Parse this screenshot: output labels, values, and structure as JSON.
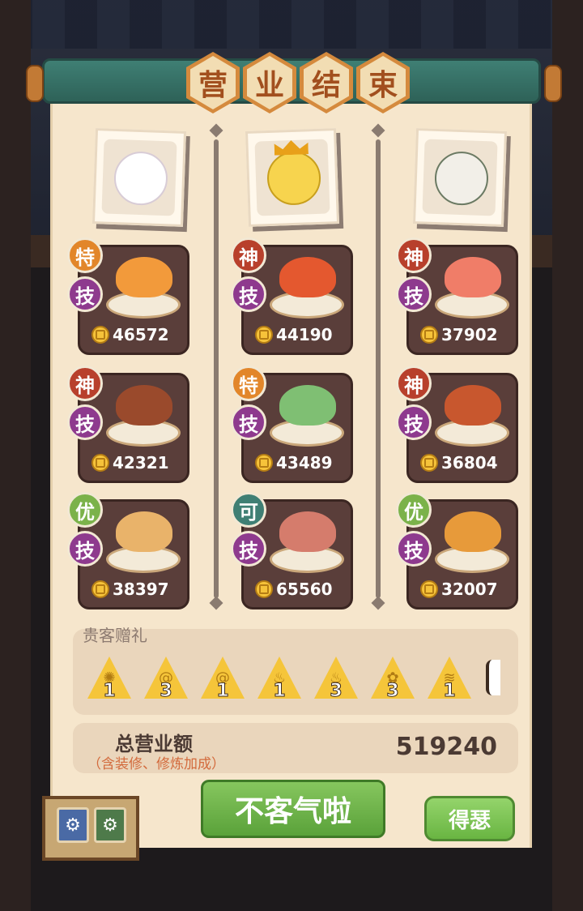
{
  "title_chars": [
    "营",
    "业",
    "结",
    "束"
  ],
  "columns": [
    {
      "portrait": "cat-character",
      "dishes": [
        {
          "grade": "特",
          "grade_color": "#e2862a",
          "skill": "技",
          "value": "46572",
          "food_color": "#f29a3b"
        },
        {
          "grade": "神",
          "grade_color": "#b8402c",
          "skill": "技",
          "value": "42321",
          "food_color": "#9a4a2c"
        },
        {
          "grade": "优",
          "grade_color": "#7bb24a",
          "skill": "技",
          "value": "38397",
          "food_color": "#e9b36a"
        }
      ]
    },
    {
      "portrait": "chick-king-character",
      "dishes": [
        {
          "grade": "神",
          "grade_color": "#b8402c",
          "skill": "技",
          "value": "44190",
          "food_color": "#e4582f"
        },
        {
          "grade": "特",
          "grade_color": "#e2862a",
          "skill": "技",
          "value": "43489",
          "food_color": "#7fbf73"
        },
        {
          "grade": "可",
          "grade_color": "#3f7f74",
          "skill": "技",
          "value": "65560",
          "food_color": "#d57c6c"
        }
      ]
    },
    {
      "portrait": "sheep-girl-character",
      "dishes": [
        {
          "grade": "神",
          "grade_color": "#b8402c",
          "skill": "技",
          "value": "37902",
          "food_color": "#f07d68"
        },
        {
          "grade": "神",
          "grade_color": "#b8402c",
          "skill": "技",
          "value": "36804",
          "food_color": "#c8572e"
        },
        {
          "grade": "优",
          "grade_color": "#7bb24a",
          "skill": "技",
          "value": "32007",
          "food_color": "#e79a3a"
        }
      ]
    }
  ],
  "gifts": {
    "label": "贵客赠礼",
    "items": [
      {
        "icon": "coral-gift-icon",
        "qty": "1"
      },
      {
        "icon": "spiral-gift-icon",
        "qty": "3"
      },
      {
        "icon": "spiral-gift-icon",
        "qty": "1"
      },
      {
        "icon": "flame-gift-icon",
        "qty": "1"
      },
      {
        "icon": "flame-gift-icon",
        "qty": "3"
      },
      {
        "icon": "flower-gift-icon",
        "qty": "3"
      },
      {
        "icon": "fish-gift-icon",
        "qty": "1"
      }
    ]
  },
  "total": {
    "label": "总营业额",
    "note": "（含装修、修炼加成）",
    "value": "519240"
  },
  "buttons": {
    "main": "不客气啦",
    "side": "得瑟"
  }
}
